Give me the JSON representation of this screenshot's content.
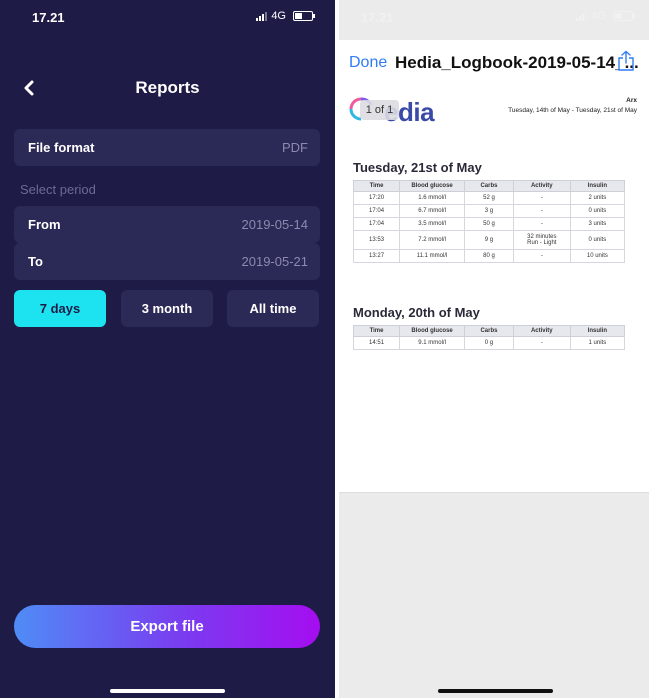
{
  "left": {
    "status": {
      "time": "17.21",
      "network": "4G"
    },
    "title": "Reports",
    "file_format": {
      "label": "File format",
      "value": "PDF"
    },
    "section_label": "Select period",
    "from": {
      "label": "From",
      "value": "2019-05-14"
    },
    "to": {
      "label": "To",
      "value": "2019-05-21"
    },
    "periods": [
      {
        "label": "7 days",
        "selected": true
      },
      {
        "label": "3 month",
        "selected": false
      },
      {
        "label": "All time",
        "selected": false
      }
    ],
    "export_label": "Export file",
    "colors": {
      "background": "#1e1b46",
      "row": "#2b2955",
      "accent": "#1de3f0"
    }
  },
  "right": {
    "status": {
      "time": "17.21",
      "network": "4G"
    },
    "done_label": "Done",
    "file_name": "Hedia_Logbook-2019-05-14_...",
    "share_icon": "share-icon",
    "document": {
      "logo_text": "edia",
      "page_badge": "1 of 1",
      "user_name": "Arx",
      "date_range": "Tuesday, 14th of May - Tuesday, 21st of May",
      "columns": [
        "Time",
        "Blood glucose",
        "Carbs",
        "Activity",
        "Insulin"
      ],
      "days": [
        {
          "heading": "Tuesday, 21st of May",
          "rows": [
            [
              "17:20",
              "1.6 mmol/l",
              "52 g",
              "-",
              "2 units"
            ],
            [
              "17:04",
              "6.7 mmol/l",
              "3 g",
              "-",
              "0 units"
            ],
            [
              "17:04",
              "3.5 mmol/l",
              "50 g",
              "-",
              "3 units"
            ],
            [
              "13:53",
              "7.2 mmol/l",
              "9 g",
              "32 minutes\nRun - Light",
              "0 units"
            ],
            [
              "13:27",
              "11.1 mmol/l",
              "80 g",
              "-",
              "10 units"
            ]
          ]
        },
        {
          "heading": "Monday, 20th of May",
          "rows": [
            [
              "14:51",
              "9.1 mmol/l",
              "0 g",
              "-",
              "1 units"
            ]
          ]
        }
      ]
    },
    "colors": {
      "link": "#2f7cf6",
      "logo": "#3b4aa8"
    }
  }
}
